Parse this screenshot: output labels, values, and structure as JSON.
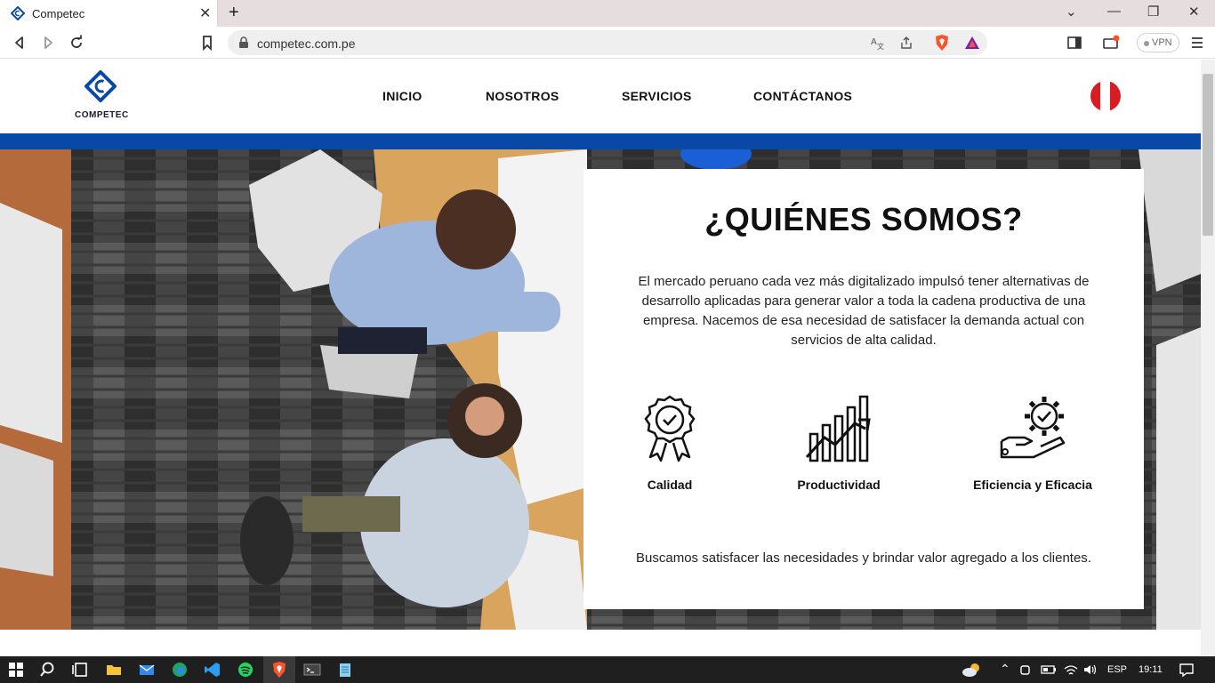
{
  "browser": {
    "tab_title": "Competec",
    "url": "competec.com.pe",
    "vpn_label": "VPN"
  },
  "site": {
    "logo_text": "COMPETEC",
    "nav": [
      "INICIO",
      "NOSOTROS",
      "SERVICIOS",
      "CONTÁCTANOS"
    ],
    "accent_color": "#0a48a5"
  },
  "about": {
    "title": "¿QUIÉNES SOMOS?",
    "description": "El mercado peruano cada vez más digitalizado impulsó tener alternativas de desarrollo aplicadas para generar valor a toda la cadena productiva de una empresa. Nacemos de esa necesidad de satisfacer la demanda actual con servicios de alta calidad.",
    "features": [
      {
        "label": "Calidad",
        "icon": "award-icon"
      },
      {
        "label": "Productividad",
        "icon": "growth-chart-icon"
      },
      {
        "label": "Eficiencia y Eficacia",
        "icon": "gear-hand-icon"
      }
    ],
    "footer": "Buscamos satisfacer las necesidades y brindar valor agregado a los clientes."
  },
  "taskbar": {
    "language": "ESP",
    "time": "19:11"
  }
}
